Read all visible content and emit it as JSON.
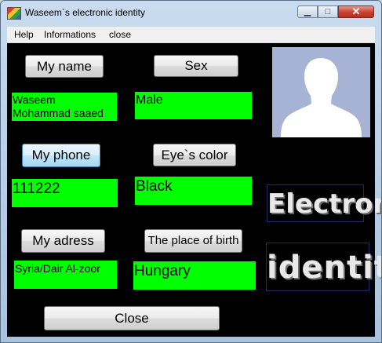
{
  "window": {
    "title": "Waseem`s electronic identity",
    "min_glyph": "▁",
    "max_glyph": "□",
    "close_glyph": "✕"
  },
  "menu": {
    "items": [
      "Help",
      "Informations",
      "close"
    ]
  },
  "form": {
    "name_button": "My name",
    "name_value": "Waseem\nMohammad saaed",
    "sex_button": "Sex",
    "sex_value": "Male",
    "phone_button": "My phone",
    "phone_value": "111222",
    "eye_button": "Eye`s color",
    "eye_value": "Black",
    "address_button": "My adress",
    "address_value": "Syria/Dair Al-zoor",
    "birth_button": "The place of birth",
    "birth_value": "Hungary",
    "close_button": "Close"
  },
  "banner": {
    "line1": "Electronic",
    "line2": "identity"
  },
  "colors": {
    "field_bg": "#00ff00",
    "client_bg": "#000000",
    "photo_bg": "#a7b3d4"
  },
  "icons": {
    "app": "app-icon",
    "avatar": "avatar-placeholder-icon"
  }
}
